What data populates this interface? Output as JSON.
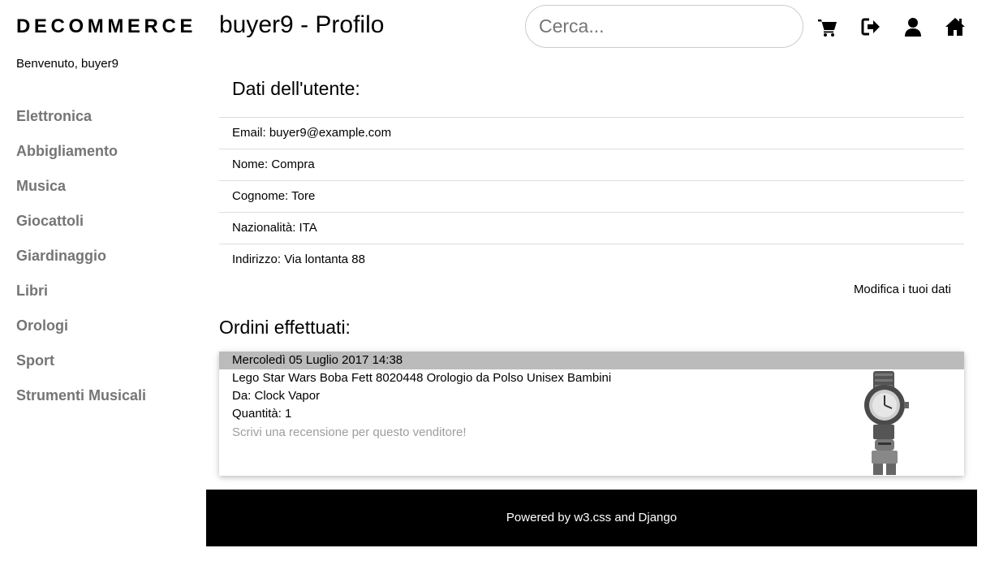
{
  "brand": "DECOMMERCE",
  "welcome": "Benvenuto, buyer9",
  "categories": [
    "Elettronica",
    "Abbigliamento",
    "Musica",
    "Giocattoli",
    "Giardinaggio",
    "Libri",
    "Orologi",
    "Sport",
    "Strumenti Musicali"
  ],
  "page_title": "buyer9 - Profilo",
  "search": {
    "placeholder": "Cerca...",
    "value": ""
  },
  "nav_icons": [
    "cart-icon",
    "sign-out-icon",
    "user-icon",
    "home-icon"
  ],
  "user": {
    "heading": "Dati dell'utente:",
    "email": "Email: buyer9@example.com",
    "nome": "Nome: Compra",
    "cognome": "Cognome: Tore",
    "nazionalita": "Nazionalità: ITA",
    "indirizzo": "Indirizzo: Via lontanta 88",
    "edit_label": "Modifica i tuoi dati"
  },
  "orders": {
    "title": "Ordini effettuati:",
    "items": [
      {
        "date": "Mercoledì 05 Luglio 2017 14:38",
        "product": "Lego Star Wars Boba Fett 8020448 Orologio da Polso Unisex Bambini",
        "seller_prefix": "Da:",
        "seller": "Clock Vapor",
        "quantity": "Quantità: 1",
        "review": "Scrivi una recensione per questo venditore!"
      }
    ]
  },
  "footer": {
    "prefix": "Powered by",
    "link1": "w3.css",
    "middle": "and",
    "link2": "Django"
  },
  "colors": {
    "category_text": "#757575",
    "order_header_bg": "#bbbbbb",
    "footer_bg": "#000000",
    "review_text": "#9e9e9e"
  }
}
